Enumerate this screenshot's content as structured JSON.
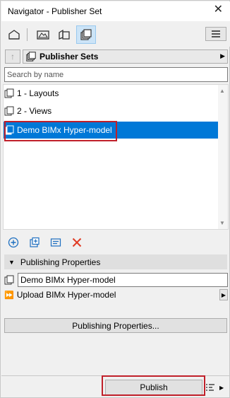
{
  "window": {
    "title": "Navigator - Publisher Set"
  },
  "toolbar": {
    "buttons": [
      {
        "icon": "project-map-icon"
      },
      {
        "icon": "view-map-icon"
      },
      {
        "icon": "layout-book-icon"
      },
      {
        "icon": "publisher-sets-icon",
        "active": true
      }
    ],
    "menu_icon": "menu-icon"
  },
  "nav": {
    "up_icon": "up-arrow-icon",
    "dropdown_label": "Publisher Sets"
  },
  "search": {
    "placeholder": "Search by name"
  },
  "tree": {
    "items": [
      {
        "label": "1 - Layouts",
        "selected": false
      },
      {
        "label": "2 - Views",
        "selected": false
      },
      {
        "label": "Demo BIMx Hyper-model",
        "selected": true
      }
    ]
  },
  "actions": {
    "buttons": [
      {
        "name": "new-publisher-set-button",
        "icon": "add-circle-icon"
      },
      {
        "name": "new-folder-button",
        "icon": "add-folder-icon"
      },
      {
        "name": "settings-button",
        "icon": "settings-icon"
      },
      {
        "name": "delete-button",
        "icon": "delete-x-icon"
      }
    ]
  },
  "publishing": {
    "header": "Publishing Properties",
    "set_name": "Demo BIMx Hyper-model",
    "method": "Upload BIMx Hyper-model",
    "properties_button": "Publishing Properties...",
    "publish_button": "Publish"
  },
  "colors": {
    "selection": "#0078d7",
    "highlight": "#c0202a",
    "delete": "#e03b24"
  }
}
